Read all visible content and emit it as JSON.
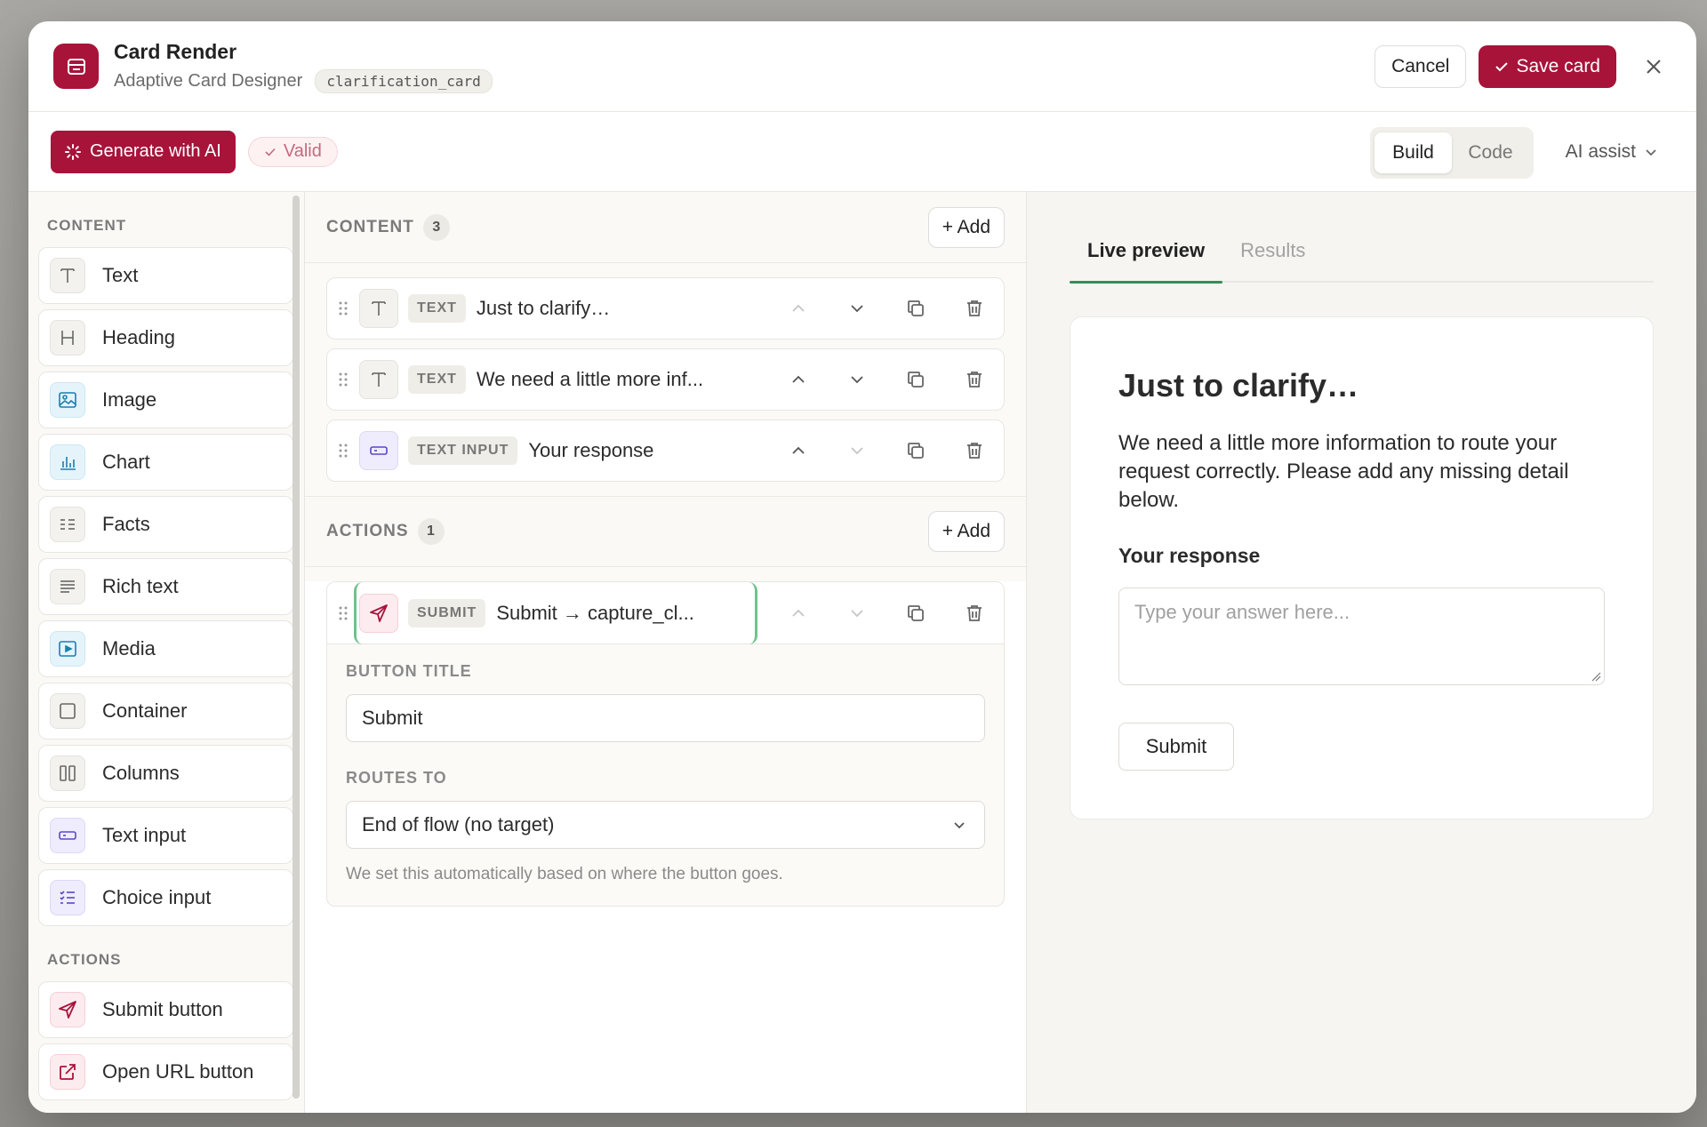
{
  "header": {
    "title": "Card Render",
    "subtitle": "Adaptive Card Designer",
    "card_id": "clarification_card",
    "cancel_label": "Cancel",
    "save_label": "Save card"
  },
  "toolbar": {
    "generate_label": "Generate with AI",
    "valid_label": "Valid",
    "mode_build": "Build",
    "mode_code": "Code",
    "active_mode": "Build",
    "ai_assist_label": "AI assist"
  },
  "sidebar": {
    "content_heading": "CONTENT",
    "content_items": [
      {
        "label": "Text",
        "icon": "text-icon"
      },
      {
        "label": "Heading",
        "icon": "heading-icon"
      },
      {
        "label": "Image",
        "icon": "image-icon"
      },
      {
        "label": "Chart",
        "icon": "chart-icon"
      },
      {
        "label": "Facts",
        "icon": "facts-icon"
      },
      {
        "label": "Rich text",
        "icon": "rich-text-icon"
      },
      {
        "label": "Media",
        "icon": "media-icon"
      },
      {
        "label": "Container",
        "icon": "container-icon"
      },
      {
        "label": "Columns",
        "icon": "columns-icon"
      },
      {
        "label": "Text input",
        "icon": "text-input-icon"
      },
      {
        "label": "Choice input",
        "icon": "choice-input-icon"
      }
    ],
    "actions_heading": "ACTIONS",
    "action_items": [
      {
        "label": "Submit button",
        "icon": "send-icon"
      },
      {
        "label": "Open URL button",
        "icon": "external-link-icon"
      }
    ]
  },
  "content_section": {
    "title": "CONTENT",
    "count": "3",
    "add_label": "+ Add",
    "rows": [
      {
        "type": "TEXT",
        "label": "Just to clarify…"
      },
      {
        "type": "TEXT",
        "label": "We need a little more inf..."
      },
      {
        "type": "TEXT INPUT",
        "label": "Your response"
      }
    ]
  },
  "actions_section": {
    "title": "ACTIONS",
    "count": "1",
    "add_label": "+ Add",
    "row": {
      "type": "SUBMIT",
      "label": "Submit → capture_cl..."
    },
    "button_title_label": "BUTTON TITLE",
    "button_title_value": "Submit",
    "routes_to_label": "ROUTES TO",
    "routes_to_value": "End of flow (no target)",
    "hint": "We set this automatically based on where the button goes."
  },
  "preview": {
    "tab_live": "Live preview",
    "tab_results": "Results",
    "title": "Just to clarify…",
    "body": "We need a little more information to route your request correctly. Please add any missing detail below.",
    "input_label": "Your response",
    "input_placeholder": "Type your answer here...",
    "submit_label": "Submit"
  },
  "colors": {
    "brand": "#a8133a",
    "accent_green": "#3b8a5a"
  }
}
